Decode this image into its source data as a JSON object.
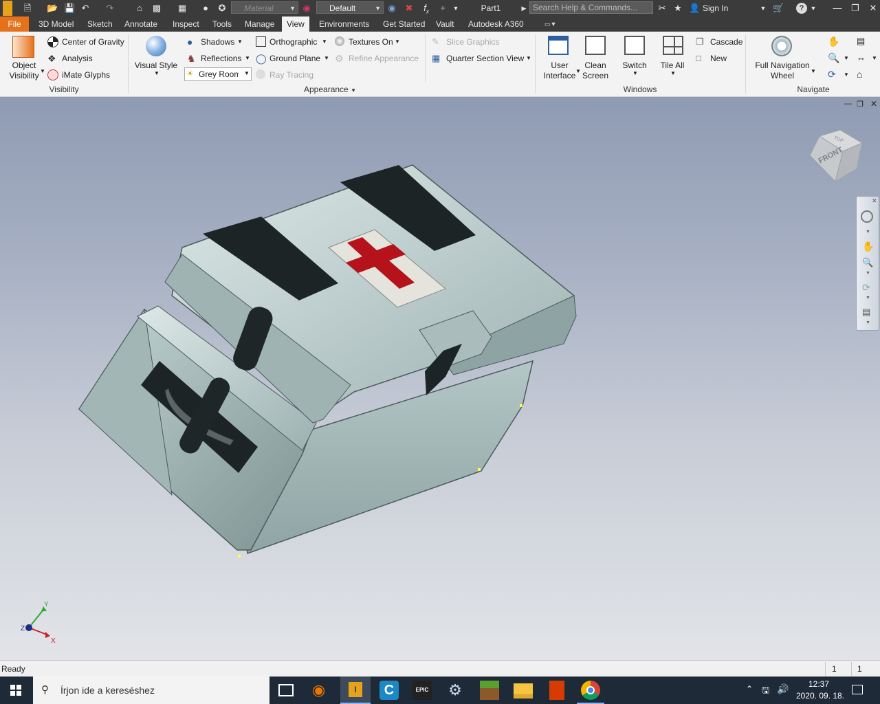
{
  "qat": {
    "material_placeholder": "Material",
    "appearance_value": "Default",
    "document_title": "Part1",
    "search_placeholder": "Search Help & Commands...",
    "sign_in": "Sign In",
    "help": "?"
  },
  "tabs": [
    "File",
    "3D Model",
    "Sketch",
    "Annotate",
    "Inspect",
    "Tools",
    "Manage",
    "View",
    "Environments",
    "Get Started",
    "Vault",
    "Autodesk A360"
  ],
  "active_tab": "View",
  "ribbon": {
    "visibility": {
      "object_visibility_1": "Object",
      "object_visibility_2": "Visibility",
      "center_of_gravity": "Center of Gravity",
      "analysis": "Analysis",
      "imate_glyphs": "iMate Glyphs",
      "group_label": "Visibility"
    },
    "appearance": {
      "visual_style": "Visual Style",
      "shadows": "Shadows",
      "reflections": "Reflections",
      "lighting_value": "Grey Room",
      "orthographic": "Orthographic",
      "ground_plane": "Ground Plane",
      "ray_tracing": "Ray Tracing",
      "textures_on": "Textures On",
      "refine_appearance": "Refine Appearance",
      "slice_graphics": "Slice Graphics",
      "quarter_section_view": "Quarter Section View",
      "group_label": "Appearance"
    },
    "windows": {
      "user_interface_1": "User",
      "user_interface_2": "Interface",
      "clean_screen_1": "Clean",
      "clean_screen_2": "Screen",
      "switch": "Switch",
      "tile_all": "Tile All",
      "cascade": "Cascade",
      "new": "New",
      "group_label": "Windows"
    },
    "navigate": {
      "full_nav_wheel_1": "Full Navigation",
      "full_nav_wheel_2": "Wheel",
      "group_label": "Navigate"
    }
  },
  "viewcube": {
    "face_front": "FRONT",
    "face_top": "TOP"
  },
  "triad": {
    "x": "X",
    "y": "Y",
    "z": "Z"
  },
  "status": {
    "text": "Ready",
    "field1": "1",
    "field2": "1"
  },
  "taskbar": {
    "search_placeholder": "Írjon ide a kereséshez",
    "time": "12:37",
    "date": "2020. 09. 18."
  },
  "colors": {
    "chrome_dark": "#3b3b3b",
    "file_tab": "#e6711a",
    "model_body": "#9fb3b3",
    "strap": "#1c2426",
    "cross": "#b5121b"
  }
}
